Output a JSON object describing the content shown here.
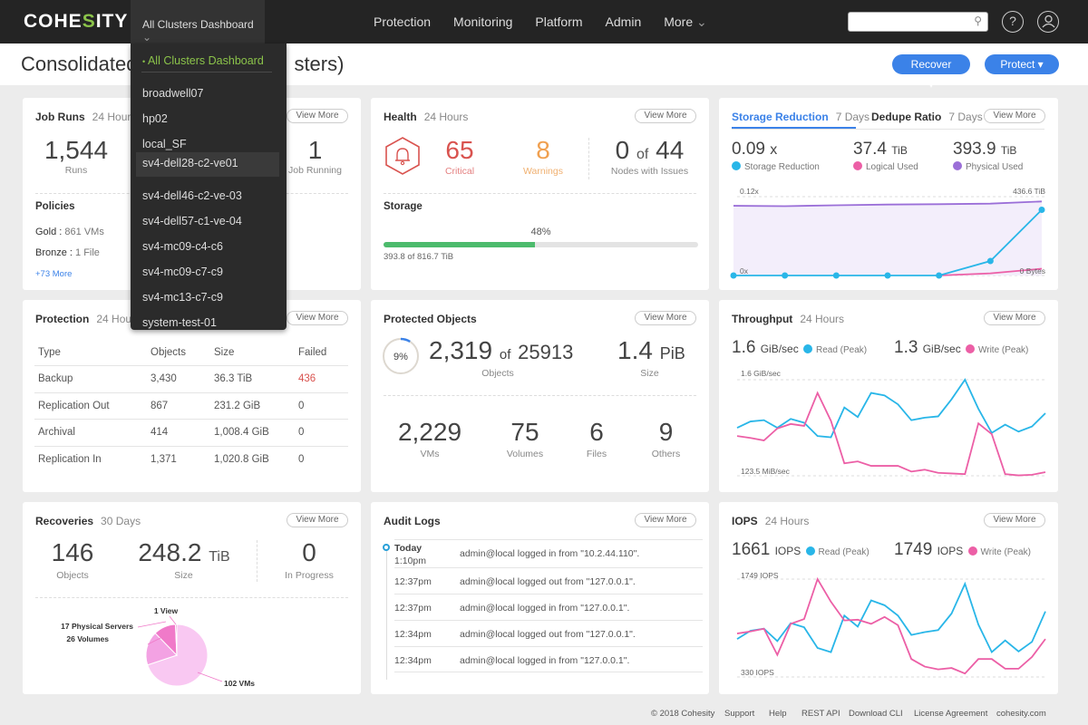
{
  "app": {
    "logo_prefix": "COHE",
    "logo_s": "S",
    "logo_suffix": "ITY"
  },
  "topbar": {
    "cluster_selector": "All Clusters Dashboard",
    "nav": [
      "Protection",
      "Monitoring",
      "Platform",
      "Admin",
      "More"
    ],
    "search_placeholder": "",
    "help_icon": "?",
    "user_icon": "user"
  },
  "subheader": {
    "title": "Consolidated Dashboard (All Clusters)",
    "title_visible_left": "Consolidated",
    "title_visible_right": "sters)",
    "recover_label": "Recover",
    "protect_label": "Protect"
  },
  "cluster_dropdown": {
    "items": [
      "All Clusters Dashboard",
      "broadwell07",
      "hp02",
      "local_SF",
      "sv4-dell28-c2-ve01",
      "sv4-dell46-c2-ve-03",
      "sv4-dell57-c1-ve-04",
      "sv4-mc09-c4-c6",
      "sv4-mc09-c7-c9",
      "sv4-mc13-c7-c9",
      "system-test-01"
    ],
    "selected": "All Clusters Dashboard",
    "hovered": "sv4-dell28-c2-ve01"
  },
  "view_more": "View More",
  "job_runs": {
    "title": "Job Runs",
    "period": "24 Hours",
    "runs": "1,544",
    "runs_label": "Runs",
    "running": "1",
    "running_label": "Job Running",
    "policies_title": "Policies",
    "policies": [
      {
        "name": "Gold",
        "value": "861 VMs"
      },
      {
        "name": "Bronze",
        "value": "1 File"
      }
    ],
    "more_link": "+73 More"
  },
  "health": {
    "title": "Health",
    "period": "24 Hours",
    "critical": "65",
    "critical_label": "Critical",
    "warnings": "8",
    "warnings_label": "Warnings",
    "nodes_issue": "0",
    "nodes_of": "of",
    "nodes_total": "44",
    "nodes_label": "Nodes with Issues",
    "storage_title": "Storage",
    "storage_percent": 48,
    "storage_percent_label": "48%",
    "storage_detail": "393.8 of 816.7 TiB",
    "colors": {
      "critical": "#d9534f",
      "warning": "#f0a050",
      "bar": "#4cbb6c"
    }
  },
  "storage_reduction": {
    "tab_active": "Storage Reduction",
    "tab_active_period": "7 Days",
    "tab_other": "Dedupe Ratio",
    "tab_other_period": "7 Days",
    "stats": [
      {
        "value": "0.09",
        "unit": "x",
        "label": "Storage Reduction",
        "color": "#29b6e8"
      },
      {
        "value": "37.4",
        "unit": "TiB",
        "label": "Logical Used",
        "color": "#ec5fa6"
      },
      {
        "value": "393.9",
        "unit": "TiB",
        "label": "Physical Used",
        "color": "#9b6fd8"
      }
    ],
    "axis_top_left": "0.12x",
    "axis_top_right": "436.6 TiB",
    "axis_bottom_left": "0x",
    "axis_bottom_right": "0 Bytes"
  },
  "protection": {
    "title": "Protection",
    "period": "24 Hours",
    "columns": [
      "Type",
      "Objects",
      "Size",
      "Failed"
    ],
    "rows": [
      [
        "Backup",
        "3,430",
        "36.3 TiB",
        "436"
      ],
      [
        "Replication Out",
        "867",
        "231.2 GiB",
        "0"
      ],
      [
        "Archival",
        "414",
        "1,008.4 GiB",
        "0"
      ],
      [
        "Replication In",
        "1,371",
        "1,020.8 GiB",
        "0"
      ]
    ]
  },
  "protected_objects": {
    "title": "Protected Objects",
    "percent": 9,
    "percent_label": "9%",
    "objects": "2,319",
    "of": "of",
    "total": "25913",
    "objects_label": "Objects",
    "size": "1.4",
    "size_unit": "PiB",
    "size_label": "Size",
    "breakdown": [
      {
        "value": "2,229",
        "label": "VMs"
      },
      {
        "value": "75",
        "label": "Volumes"
      },
      {
        "value": "6",
        "label": "Files"
      },
      {
        "value": "9",
        "label": "Others"
      }
    ]
  },
  "throughput": {
    "title": "Throughput",
    "period": "24 Hours",
    "read_value": "1.6",
    "read_unit": "GiB/sec",
    "read_label": "Read (Peak)",
    "write_value": "1.3",
    "write_unit": "GiB/sec",
    "write_label": "Write (Peak)",
    "axis_top": "1.6 GiB/sec",
    "axis_bottom": "123.5 MiB/sec"
  },
  "recoveries": {
    "title": "Recoveries",
    "period": "30 Days",
    "objects": "146",
    "objects_label": "Objects",
    "size": "248.2",
    "size_unit": "TiB",
    "size_label": "Size",
    "in_progress": "0",
    "in_progress_label": "In Progress"
  },
  "audit_logs": {
    "title": "Audit Logs",
    "day": "Today",
    "entries": [
      {
        "time": "1:10pm",
        "text": "admin@local logged in from \"10.2.44.110\"."
      },
      {
        "time": "12:37pm",
        "text": "admin@local logged out from \"127.0.0.1\"."
      },
      {
        "time": "12:37pm",
        "text": "admin@local logged in from \"127.0.0.1\"."
      },
      {
        "time": "12:34pm",
        "text": "admin@local logged out from \"127.0.0.1\"."
      },
      {
        "time": "12:34pm",
        "text": "admin@local logged in from \"127.0.0.1\"."
      }
    ]
  },
  "iops": {
    "title": "IOPS",
    "period": "24 Hours",
    "read_value": "1661",
    "read_unit": "IOPS",
    "read_label": "Read (Peak)",
    "write_value": "1749",
    "write_unit": "IOPS",
    "write_label": "Write (Peak)",
    "axis_top": "1749 IOPS",
    "axis_bottom": "330 IOPS"
  },
  "footer": [
    "© 2018 Cohesity",
    "Support",
    "Help",
    "REST API",
    "Download CLI",
    "License Agreement",
    "cohesity.com"
  ],
  "chart_data": [
    {
      "id": "storage_reduction",
      "type": "line",
      "x": [
        1,
        2,
        3,
        4,
        5,
        6,
        7
      ],
      "series": [
        {
          "name": "Storage Reduction",
          "color": "#29b6e8",
          "values": [
            0,
            0,
            0,
            0,
            0,
            0.022,
            0.1
          ],
          "ylim": [
            0,
            0.12
          ],
          "markers": true
        },
        {
          "name": "Physical Used",
          "color": "#9b6fd8",
          "values": [
            386,
            384,
            389,
            393,
            395,
            398,
            410
          ],
          "ylim": [
            0,
            436.6
          ],
          "fill": true
        },
        {
          "name": "Logical Used",
          "color": "#ec5fa6",
          "values": [
            null,
            null,
            null,
            null,
            0,
            12,
            37.4
          ],
          "ylim": [
            0,
            436.6
          ]
        }
      ]
    },
    {
      "id": "throughput",
      "type": "line",
      "ylim": [
        123.5,
        1638
      ],
      "series": [
        {
          "name": "Read (Peak)",
          "color": "#29b6e8",
          "values": [
            880,
            980,
            1000,
            880,
            1020,
            960,
            750,
            730,
            1200,
            1050,
            1430,
            1390,
            1250,
            1000,
            1040,
            1060,
            1330,
            1638,
            1180,
            800,
            930,
            820,
            900,
            1110
          ]
        },
        {
          "name": "Write (Peak)",
          "color": "#ec5fa6",
          "values": [
            750,
            720,
            680,
            870,
            940,
            910,
            1430,
            990,
            320,
            350,
            280,
            280,
            280,
            190,
            220,
            170,
            160,
            150,
            950,
            780,
            150,
            130,
            140,
            180
          ]
        }
      ]
    },
    {
      "id": "iops",
      "type": "line",
      "ylim": [
        330,
        1749
      ],
      "series": [
        {
          "name": "Read (Peak)",
          "color": "#29b6e8",
          "values": [
            880,
            1000,
            1030,
            850,
            1110,
            1050,
            750,
            690,
            1220,
            1060,
            1440,
            1370,
            1220,
            940,
            980,
            1010,
            1250,
            1680,
            1090,
            690,
            860,
            700,
            840,
            1280
          ]
        },
        {
          "name": "Write (Peak)",
          "color": "#ec5fa6",
          "values": [
            960,
            990,
            1030,
            650,
            1100,
            1170,
            1749,
            1420,
            1150,
            1160,
            1100,
            1200,
            1080,
            590,
            480,
            440,
            460,
            380,
            590,
            590,
            450,
            450,
            620,
            880
          ]
        }
      ]
    },
    {
      "id": "recoveries_pie",
      "type": "pie",
      "categories": [
        "102 VMs",
        "26 Volumes",
        "17 Physical Servers",
        "1 View"
      ],
      "values": [
        102,
        26,
        17,
        1
      ],
      "colors": [
        "#f9c8f2",
        "#f3a2e3",
        "#f07ac9",
        "#e055b0"
      ]
    }
  ]
}
